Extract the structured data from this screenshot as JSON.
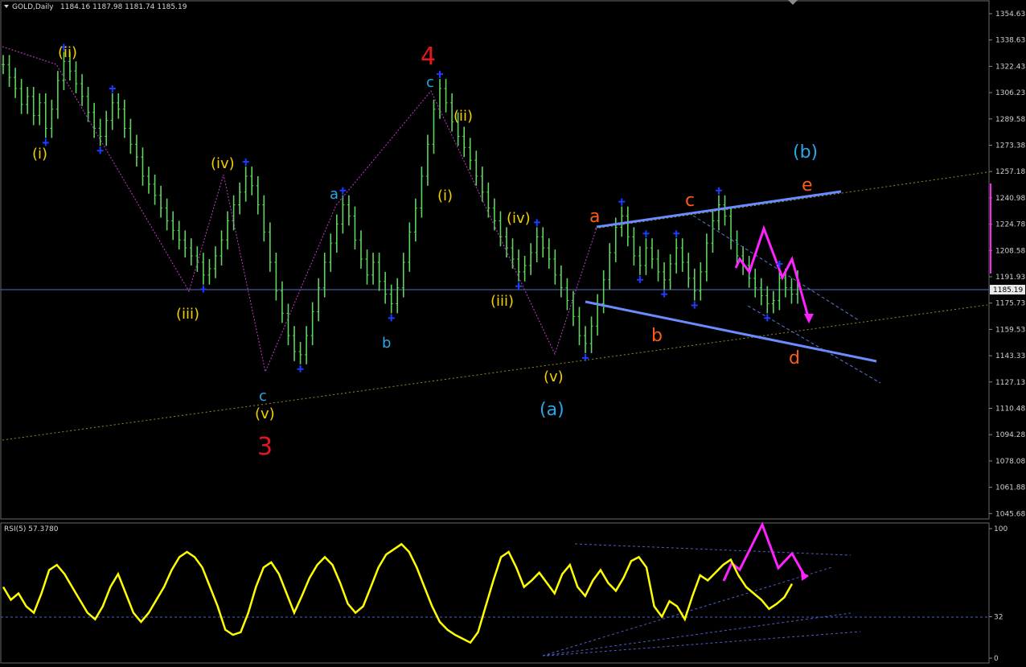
{
  "header": {
    "symbol": "GOLD,Daily",
    "ohlc": "1184.16 1187.98 1181.74 1185.19"
  },
  "rsi_header": "RSI(5) 57.3780",
  "price_axis": {
    "ticks": [
      "1354.63",
      "1338.63",
      "1322.43",
      "1306.23",
      "1289.58",
      "1273.38",
      "1257.18",
      "1240.98",
      "1224.78",
      "1208.58",
      "1191.93",
      "1175.73",
      "1159.53",
      "1143.33",
      "1127.13",
      "1110.48",
      "1094.28",
      "1078.08",
      "1061.88",
      "1045.68"
    ],
    "current": "1185.19"
  },
  "rsi_axis": {
    "ticks": [
      "100",
      "32",
      "0"
    ]
  },
  "labels": {
    "big_3": "3",
    "big_4": "4",
    "bracket_a": "(a)",
    "bracket_b": "(b)",
    "roman_i_1": "(i)",
    "roman_ii_1": "(ii)",
    "roman_iii_1": "(iii)",
    "roman_iv_1": "(iv)",
    "roman_v_1": "(v)",
    "roman_i_2": "(i)",
    "roman_ii_2": "(ii)",
    "roman_iii_2": "(iii)",
    "roman_iv_2": "(iv)",
    "roman_v_2": "(v)",
    "c_left": "c",
    "a_mid": "a",
    "b_mid": "b",
    "c_top": "c",
    "tri_a": "a",
    "tri_b": "b",
    "tri_c": "c",
    "tri_d": "d",
    "tri_e": "e"
  },
  "colors": {
    "background": "#000000",
    "candle": "#5fd35f",
    "rsi_line": "#ffff00",
    "fractal": "#1e3cff",
    "channel": "#6a8cff",
    "projection": "#ff22ff",
    "wave_red": "#e3171d",
    "wave_orange": "#ff5a1a",
    "wave_cyan": "#29a7e8",
    "wave_yellow": "#f2d000",
    "trendline": "#8f8f2a"
  },
  "chart_data": {
    "type": "line",
    "title": "GOLD,Daily",
    "ylabel": "",
    "ylim": [
      1035,
      1360
    ],
    "price_series": {
      "name": "GOLD",
      "values": [
        1320,
        1312,
        1305,
        1295,
        1300,
        1288,
        1296,
        1280,
        1292,
        1310,
        1322,
        1316,
        1308,
        1300,
        1290,
        1280,
        1275,
        1285,
        1296,
        1292,
        1280,
        1270,
        1262,
        1250,
        1245,
        1238,
        1230,
        1222,
        1216,
        1210,
        1205,
        1200,
        1196,
        1188,
        1192,
        1200,
        1210,
        1222,
        1232,
        1240,
        1250,
        1244,
        1232,
        1215,
        1196,
        1178,
        1164,
        1150,
        1140,
        1138,
        1150,
        1165,
        1180,
        1196,
        1208,
        1220,
        1232,
        1225,
        1210,
        1198,
        1188,
        1196,
        1184,
        1176,
        1170,
        1180,
        1196,
        1215,
        1230,
        1250,
        1270,
        1292,
        1305,
        1296,
        1284,
        1275,
        1268,
        1260,
        1250,
        1240,
        1230,
        1222,
        1212,
        1205,
        1198,
        1190,
        1194,
        1202,
        1212,
        1205,
        1198,
        1188,
        1180,
        1172,
        1162,
        1150,
        1145,
        1156,
        1170,
        1185,
        1202,
        1218,
        1225,
        1212,
        1200,
        1194,
        1205,
        1198,
        1190,
        1185,
        1195,
        1205,
        1196,
        1186,
        1178,
        1190,
        1208,
        1222,
        1232,
        1225,
        1210,
        1200,
        1194,
        1186,
        1180,
        1175,
        1170,
        1172,
        1186,
        1180,
        1176,
        1185
      ]
    },
    "rsi_series": {
      "name": "RSI(5)",
      "ylim": [
        0,
        100
      ],
      "values": [
        55,
        45,
        50,
        40,
        35,
        50,
        68,
        72,
        65,
        55,
        45,
        35,
        30,
        40,
        55,
        65,
        50,
        35,
        28,
        35,
        45,
        55,
        68,
        78,
        82,
        78,
        70,
        55,
        40,
        22,
        18,
        20,
        35,
        55,
        70,
        74,
        65,
        50,
        35,
        48,
        62,
        72,
        78,
        72,
        58,
        42,
        35,
        40,
        55,
        70,
        80,
        84,
        88,
        82,
        70,
        55,
        40,
        28,
        22,
        18,
        15,
        12,
        20,
        40,
        60,
        78,
        82,
        70,
        55,
        60,
        66,
        58,
        50,
        65,
        72,
        55,
        48,
        60,
        68,
        58,
        52,
        62,
        75,
        78,
        70,
        40,
        32,
        44,
        40,
        30,
        48,
        64,
        60,
        66,
        72,
        76,
        64,
        55,
        50,
        45,
        38,
        42,
        47,
        57.4
      ]
    }
  }
}
